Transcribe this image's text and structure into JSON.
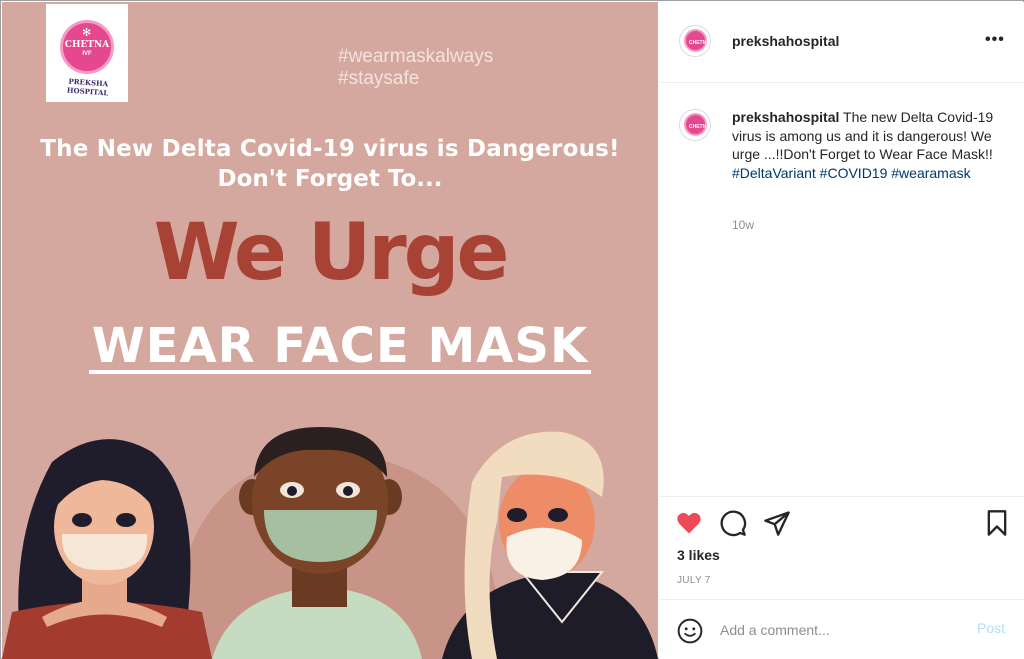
{
  "post": {
    "logo": {
      "brand": "CHETNA",
      "brand_sub": "IVF",
      "hospital": "PREKSHA HOSPITAL"
    },
    "hashtags": [
      "#wearmaskalways",
      "#staysafe"
    ],
    "headline_line1": "The New Delta Covid-19 virus is Dangerous!",
    "headline_line2": "Don't Forget To...",
    "we_urge": "We Urge",
    "wear_mask": "WEAR FACE MASK"
  },
  "sidebar": {
    "header": {
      "username": "prekshahospital",
      "more_icon": "more-horizontal-icon"
    },
    "caption": {
      "username": "prekshahospital",
      "text": " The new Delta Covid-19 virus is among us and it is dangerous! We urge ...!!Don't Forget to Wear Face Mask!! ",
      "tags": "#DeltaVariant #COVID19 #wearamask",
      "age": "10w"
    },
    "actions": {
      "like_icon": "heart-icon",
      "comment_icon": "comment-icon",
      "share_icon": "paper-plane-icon",
      "save_icon": "bookmark-icon",
      "likes": "3 likes",
      "date": "JULY 7"
    },
    "comment_box": {
      "placeholder": "Add a comment...",
      "post_label": "Post"
    }
  },
  "colors": {
    "image_bg": "#d4a89e",
    "accent_red": "#a84234",
    "liked_heart": "#ed4956",
    "link_blue": "#00376b",
    "post_disabled": "#b2dffc"
  }
}
